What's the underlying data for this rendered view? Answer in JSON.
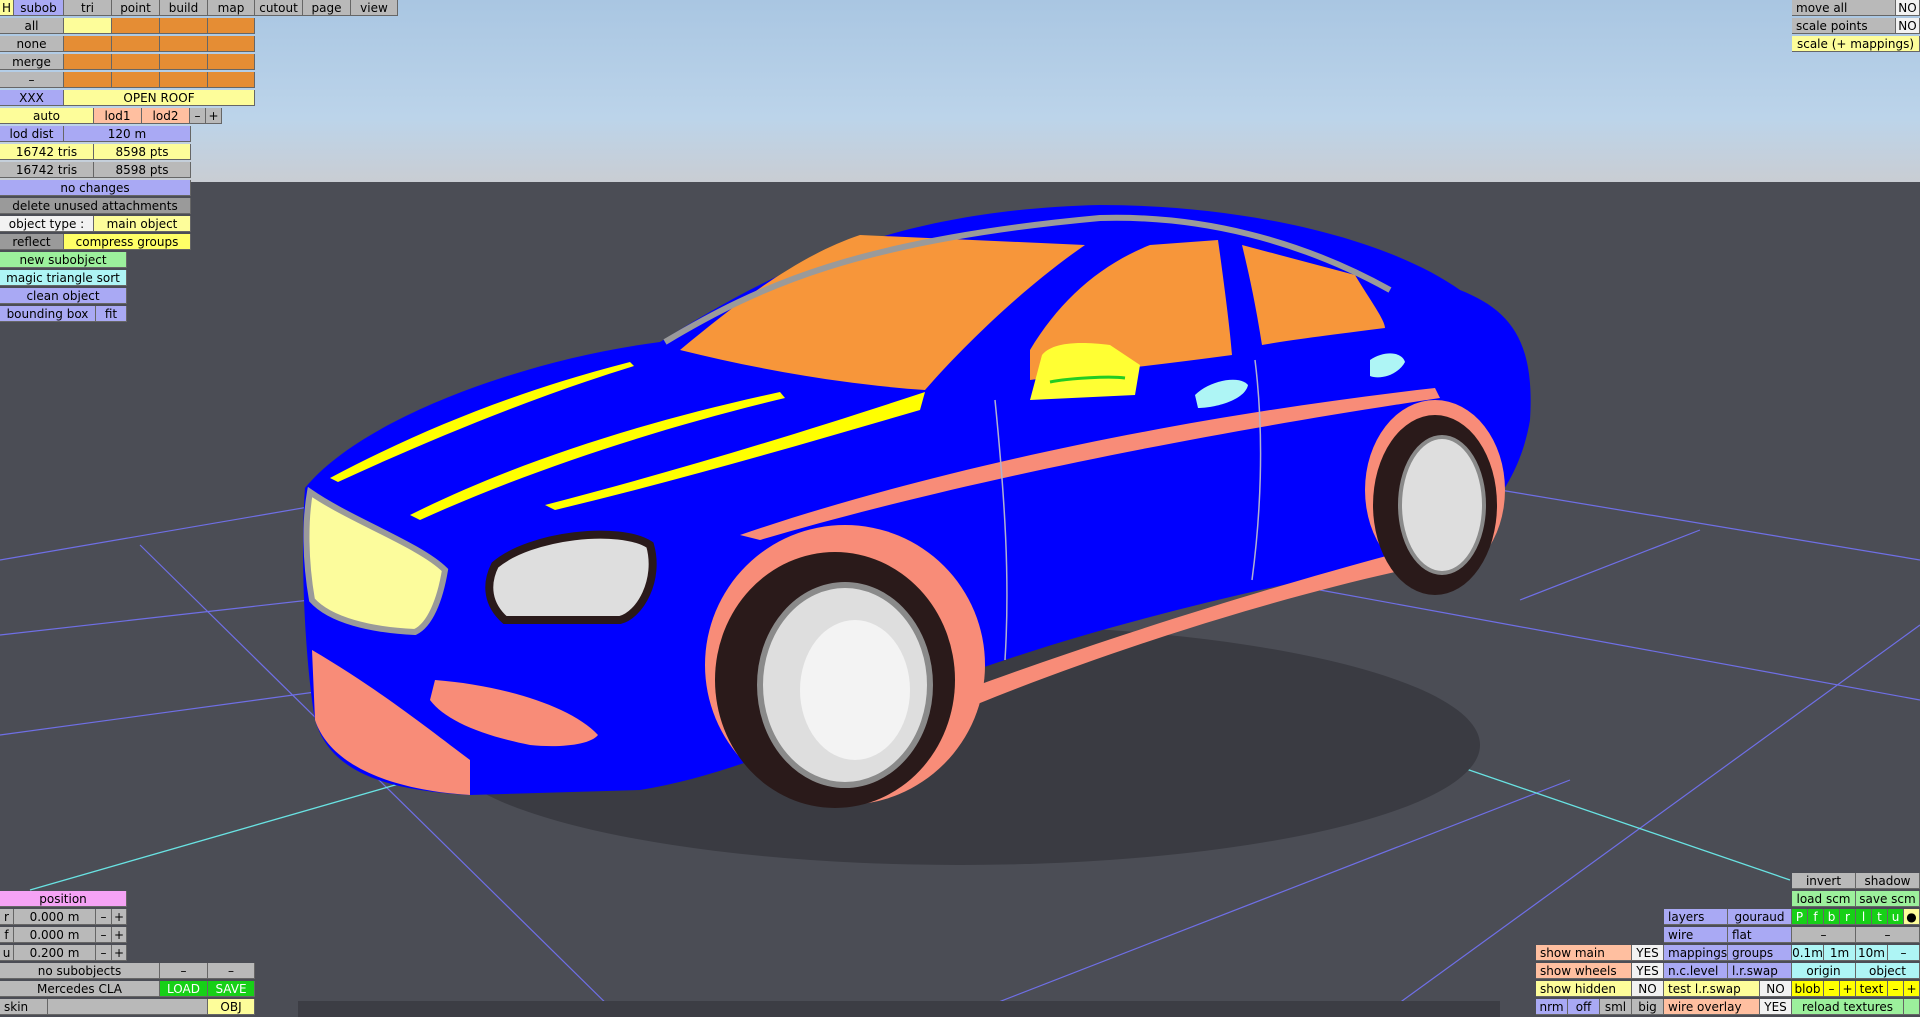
{
  "colors": {
    "body": "#0000ff",
    "glass": "#f7963a",
    "trim": "#f88c78",
    "lamp": "#fcfc9c",
    "stripe": "#ffff00",
    "mirror": "#ffff33",
    "grid": "#7070ee",
    "axis": "#69e3e3"
  },
  "top_tabs": {
    "h": "H",
    "subob": "subob",
    "tri": "tri",
    "point": "point",
    "build": "build",
    "map": "map",
    "cutout": "cutout",
    "page": "page",
    "view": "view"
  },
  "select": {
    "all": "all",
    "none": "none",
    "merge": "merge",
    "dash": "–"
  },
  "sub": {
    "name": "XXX",
    "open": "OPEN ROOF"
  },
  "lod": {
    "auto": "auto",
    "lod1": "lod1",
    "lod2": "lod2",
    "minus": "–",
    "plus": "+",
    "dist_label": "lod dist",
    "dist_value": "120 m"
  },
  "stats": {
    "tris1": "16742 tris",
    "pts1": "8598 pts",
    "tris2": "16742 tris",
    "pts2": "8598 pts"
  },
  "actions": {
    "no_changes": "no changes",
    "delete_unused": "delete unused attachments",
    "obj_type_label": "object type :",
    "obj_type_value": "main object",
    "reflect": "reflect",
    "compress": "compress groups",
    "new_sub": "new subobject",
    "magic": "magic triangle sort",
    "clean": "clean object",
    "bbox": "bounding box",
    "fit": "fit"
  },
  "topright": {
    "move_all": "move all",
    "move_all_val": "NO",
    "scale_points": "scale points",
    "scale_points_val": "NO",
    "scale_map": "scale (+ mappings)"
  },
  "position": {
    "title": "position",
    "r": "r",
    "f": "f",
    "u": "u",
    "rv": "0.000 m",
    "fv": "0.000 m",
    "uv": "0.200 m",
    "minus": "–",
    "plus": "+"
  },
  "bottomleft": {
    "no_sub": "no subobjects",
    "dash": "–",
    "name": "Mercedes CLA",
    "load": "LOAD",
    "save": "SAVE",
    "skin": "skin",
    "obj": "OBJ"
  },
  "br": {
    "invert": "invert",
    "shadow": "shadow",
    "load_scm": "load scm",
    "save_scm": "save scm",
    "layers": "layers",
    "gouraud": "gouraud",
    "wire": "wire",
    "flat": "flat",
    "mappings": "mappings",
    "groups": "groups",
    "nc_level": "n.c.level",
    "lr_swap": "l.r.swap",
    "show_main": "show main",
    "show_main_v": "YES",
    "show_wheels": "show wheels",
    "show_wheels_v": "YES",
    "show_hidden": "show hidden",
    "show_hidden_v": "NO",
    "test_lr": "test l.r.swap",
    "test_lr_v": "NO",
    "nrm": "nrm",
    "off": "off",
    "sml": "sml",
    "big": "big",
    "wire_overlay": "wire overlay",
    "wire_overlay_v": "YES",
    "v1": "0.1m",
    "v2": "1m",
    "v3": "10m",
    "dash": "–",
    "origin": "origin",
    "object": "object",
    "blob": "blob",
    "text": "text",
    "minus": "–",
    "plus": "+",
    "reload": "reload textures",
    "letters": [
      "P",
      "f",
      "b",
      "r",
      "l",
      "t",
      "u",
      "●"
    ]
  }
}
